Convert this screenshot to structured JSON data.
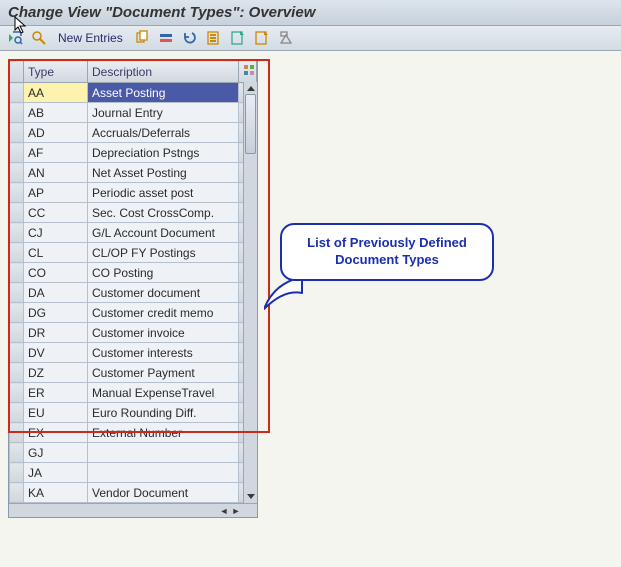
{
  "title": "Change View \"Document Types\": Overview",
  "toolbar": {
    "new_entries": "New Entries"
  },
  "table": {
    "headers": {
      "type": "Type",
      "description": "Description"
    },
    "rows": [
      {
        "type": "AA",
        "desc": "Asset Posting",
        "selected": true
      },
      {
        "type": "AB",
        "desc": "Journal Entry"
      },
      {
        "type": "AD",
        "desc": "Accruals/Deferrals"
      },
      {
        "type": "AF",
        "desc": "Depreciation Pstngs"
      },
      {
        "type": "AN",
        "desc": "Net Asset Posting"
      },
      {
        "type": "AP",
        "desc": "Periodic asset post"
      },
      {
        "type": "CC",
        "desc": "Sec. Cost CrossComp."
      },
      {
        "type": "CJ",
        "desc": "G/L Account Document"
      },
      {
        "type": "CL",
        "desc": "CL/OP FY Postings"
      },
      {
        "type": "CO",
        "desc": "CO Posting"
      },
      {
        "type": "DA",
        "desc": "Customer document"
      },
      {
        "type": "DG",
        "desc": "Customer credit memo"
      },
      {
        "type": "DR",
        "desc": "Customer invoice"
      },
      {
        "type": "DV",
        "desc": "Customer interests"
      },
      {
        "type": "DZ",
        "desc": "Customer Payment"
      },
      {
        "type": "ER",
        "desc": "Manual ExpenseTravel"
      },
      {
        "type": "EU",
        "desc": "Euro Rounding Diff."
      },
      {
        "type": "EX",
        "desc": "External Number"
      },
      {
        "type": "GJ",
        "desc": ""
      },
      {
        "type": "JA",
        "desc": ""
      },
      {
        "type": "KA",
        "desc": "Vendor Document"
      }
    ]
  },
  "callout": {
    "line1": "List of Previously Defined",
    "line2": "Document Types"
  }
}
